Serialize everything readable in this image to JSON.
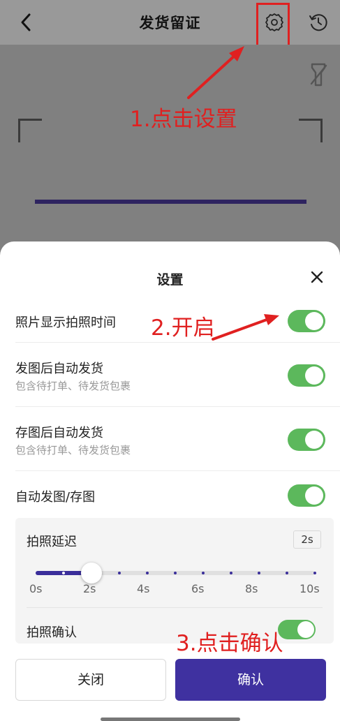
{
  "header": {
    "title": "发货留证",
    "back_icon": "chevron-left-icon",
    "settings_icon": "gear-icon",
    "history_icon": "history-icon"
  },
  "camera": {
    "flash_icon": "flash-off-icon"
  },
  "annotations": {
    "step1": "1.点击设置",
    "step2": "2.开启",
    "step3": "3.点击确认",
    "color": "#e02020"
  },
  "settings": {
    "title": "设置",
    "close_icon": "close-icon",
    "rows": [
      {
        "label": "照片显示拍照时间",
        "sub": "",
        "on": true
      },
      {
        "label": "发图后自动发货",
        "sub": "包含待打单、待发货包裹",
        "on": true
      },
      {
        "label": "存图后自动发货",
        "sub": "包含待打单、待发货包裹",
        "on": true
      },
      {
        "label": "自动发图/存图",
        "sub": "",
        "on": true
      }
    ],
    "delay": {
      "label": "拍照延迟",
      "value_badge": "2s",
      "value_seconds": 2,
      "max_seconds": 10,
      "tick_labels": [
        "0s",
        "2s",
        "4s",
        "6s",
        "8s",
        "10s"
      ]
    },
    "confirm": {
      "label": "拍照确认",
      "on": true
    }
  },
  "buttons": {
    "close": "关闭",
    "confirm": "确认"
  },
  "colors": {
    "accent": "#3f31a0",
    "toggle_on": "#5cb85c"
  }
}
